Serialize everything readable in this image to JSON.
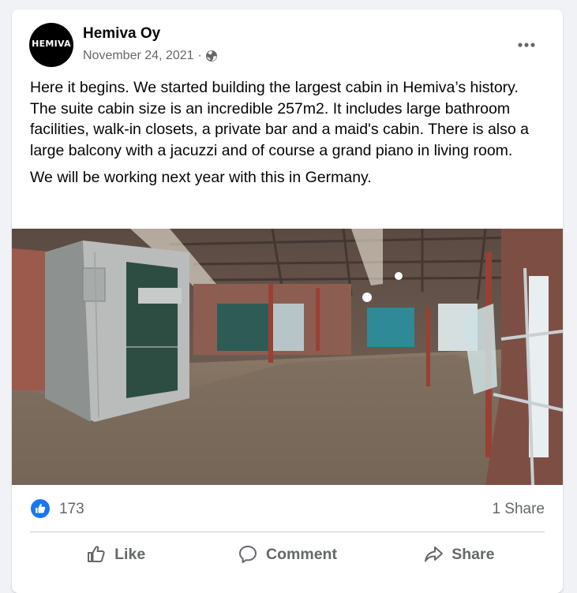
{
  "post": {
    "author": {
      "name": "Hemiva Oy",
      "avatar_text": "HEMIVA",
      "avatar_bg": "#000000"
    },
    "date": "November 24, 2021",
    "separator": "·",
    "privacy_icon": "globe-icon",
    "menu_icon": "more-horizontal-icon",
    "paragraphs": [
      "Here it begins. We started building the largest cabin in Hemiva’s history. The suite cabin size is an incredible 257m2. It includes large bathroom facilities, walk-in closets, a private bar and a maid's cabin. There is also a large balcony with a jacuzzi and of course a grand piano in living room.",
      "We will be working next year with this in Germany."
    ],
    "photo_icon": "construction-site-photo"
  },
  "stats": {
    "reactions": "173",
    "reaction_icon": "like-reaction-icon",
    "shares": "1 Share"
  },
  "actions": {
    "like": "Like",
    "comment": "Comment",
    "share": "Share"
  },
  "colors": {
    "brand_blue": "#1877f2",
    "secondary_text": "#65676b",
    "background": "#f0f2f5"
  }
}
